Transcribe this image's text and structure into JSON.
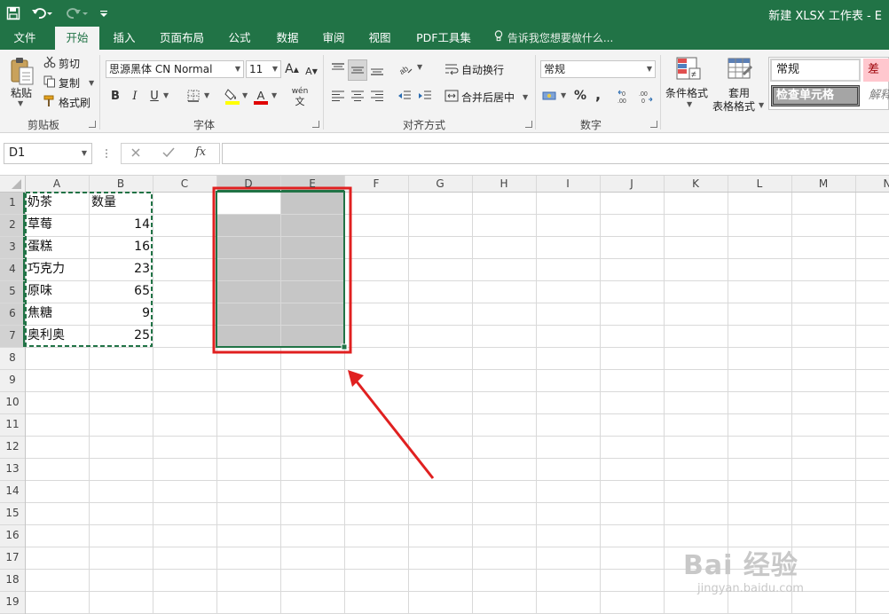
{
  "titlebar": {
    "title": "新建 XLSX 工作表 - E",
    "bg_color": "#217346",
    "icons": [
      "save-icon",
      "undo-icon",
      "redo-icon",
      "customize-qat-icon"
    ]
  },
  "tabs": [
    {
      "label": "文件",
      "active": false
    },
    {
      "label": "开始",
      "active": true
    },
    {
      "label": "插入",
      "active": false
    },
    {
      "label": "页面布局",
      "active": false
    },
    {
      "label": "公式",
      "active": false
    },
    {
      "label": "数据",
      "active": false
    },
    {
      "label": "审阅",
      "active": false
    },
    {
      "label": "视图",
      "active": false
    },
    {
      "label": "PDF工具集",
      "active": false
    }
  ],
  "tell_me": "告诉我您想要做什么...",
  "ribbon": {
    "clipboard": {
      "paste": "粘贴",
      "cut": "剪切",
      "copy": "复制",
      "format_painter": "格式刷",
      "group": "剪贴板"
    },
    "font": {
      "name": "思源黑体 CN Normal",
      "size": "11",
      "grow": "A",
      "shrink": "A",
      "bold": "B",
      "italic": "I",
      "underline": "U",
      "pinyin": "wén",
      "pinyin_sub": "文",
      "group": "字体",
      "fill_color": "#ffff00",
      "font_color": "#e00000"
    },
    "alignment": {
      "wrap": "自动换行",
      "merge": "合并后居中",
      "group": "对齐方式"
    },
    "number": {
      "format": "常规",
      "percent": "%",
      "comma": ",",
      "group": "数字"
    },
    "styles": {
      "conditional": "条件格式",
      "table_line1": "套用",
      "table_line2": "表格格式",
      "style_normal": "常规",
      "style_bad": "差",
      "style_check": "检查单元格",
      "style_explain": "解释"
    }
  },
  "formula_bar": {
    "name_box": "D1",
    "fx": "fx",
    "value": ""
  },
  "columns": [
    "A",
    "B",
    "C",
    "D",
    "E",
    "F",
    "G",
    "H",
    "I",
    "J",
    "K",
    "L",
    "M",
    "N"
  ],
  "rows": [
    "1",
    "2",
    "3",
    "4",
    "5",
    "6",
    "7",
    "8",
    "9",
    "10",
    "11",
    "12",
    "13",
    "14",
    "15",
    "16",
    "17",
    "18",
    "19"
  ],
  "table": {
    "header": [
      "奶茶",
      "数量"
    ],
    "rows": [
      [
        "草莓",
        "14"
      ],
      [
        "蛋糕",
        "16"
      ],
      [
        "巧克力",
        "23"
      ],
      [
        "原味",
        "65"
      ],
      [
        "焦糖",
        "9"
      ],
      [
        "奥利奥",
        "25"
      ]
    ]
  },
  "selection": {
    "range": "D1:E7",
    "active_cell": "D1",
    "copy_range": "A1:B7"
  },
  "colors": {
    "accent": "#217346",
    "selection_fill": "#c6c6c6",
    "annotation": "#e02020",
    "copy_border": "#217346"
  },
  "watermark": {
    "big": "Bai 经验",
    "small": "jingyan.baidu.com"
  }
}
